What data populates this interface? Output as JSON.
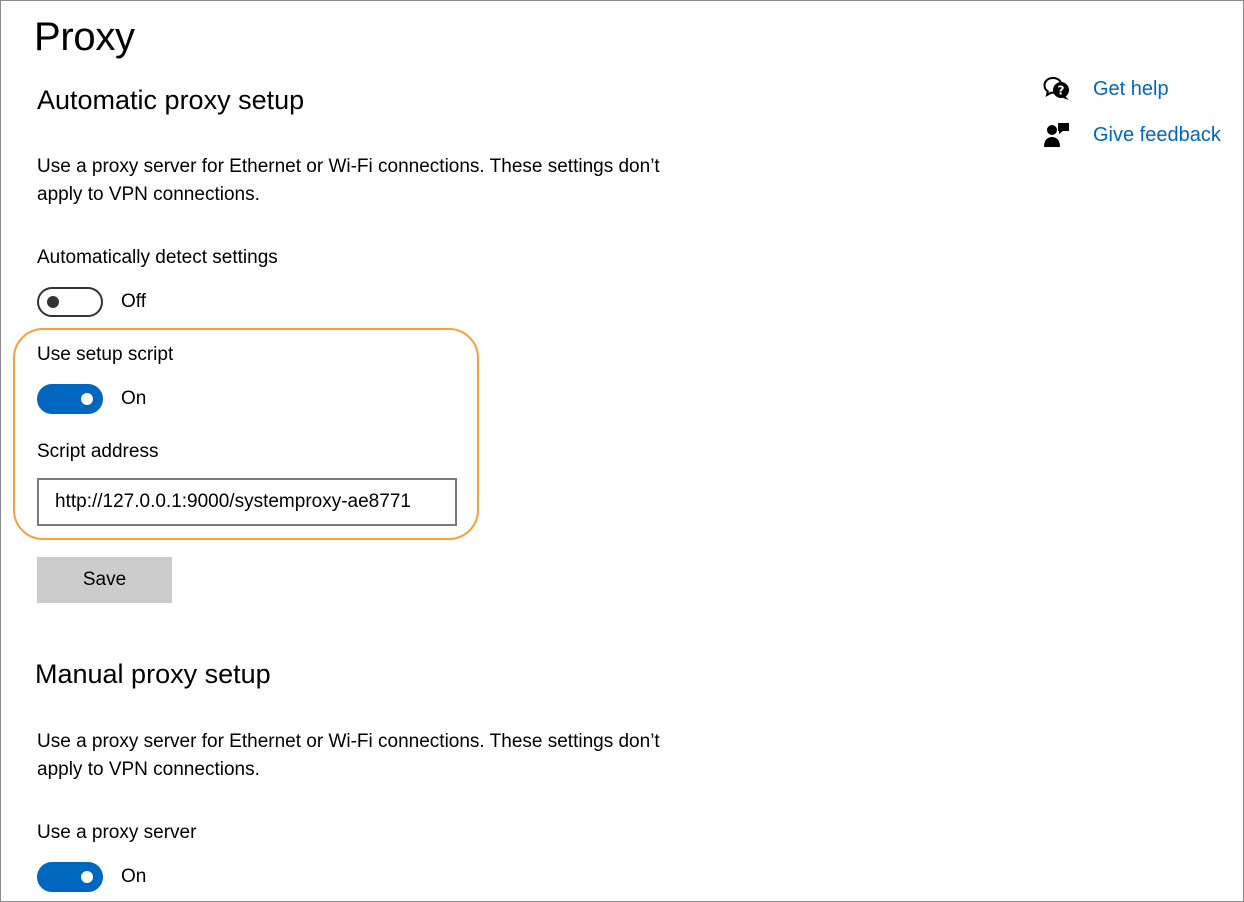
{
  "page": {
    "title": "Proxy"
  },
  "side_links": {
    "get_help": "Get help",
    "give_feedback": "Give feedback"
  },
  "automatic": {
    "title": "Automatic proxy setup",
    "description": "Use a proxy server for Ethernet or Wi-Fi connections. These settings don’t apply to VPN connections.",
    "detect_label": "Automatically detect settings",
    "detect_state": "Off",
    "script_label": "Use setup script",
    "script_state": "On",
    "address_label": "Script address",
    "address_value": "http://127.0.0.1:9000/systemproxy-ae8771",
    "save_label": "Save"
  },
  "manual": {
    "title": "Manual proxy setup",
    "description": "Use a proxy server for Ethernet or Wi-Fi connections. These settings don’t apply to VPN connections.",
    "use_proxy_label": "Use a proxy server",
    "use_proxy_state": "On"
  },
  "colors": {
    "accent": "#0067c0",
    "highlight": "#f5a23a",
    "button_bg": "#cccccc"
  },
  "icons": {
    "get_help": "help-chat-icon",
    "give_feedback": "feedback-icon"
  }
}
